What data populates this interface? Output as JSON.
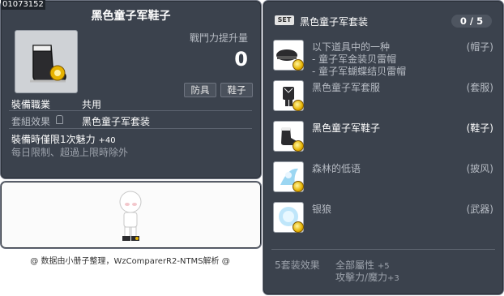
{
  "item_id": "01073152",
  "item": {
    "name": "黑色童子军鞋子",
    "combat_power_label": "戰鬥力提升量",
    "combat_power_value": "0",
    "tags": [
      "防具",
      "鞋子"
    ],
    "job_label": "裝備職業",
    "job_value": "共用",
    "set_label": "套組效果",
    "set_value": "黑色童子军套装",
    "limit_text": "裝備時僅限1次魅力",
    "limit_value": "+40",
    "limit_note": "每日限制、超過上限時除外"
  },
  "footer_credit": "@ 数据由小册子整理，WzComparerR2-NTMS解析 @",
  "set_panel": {
    "badge": "SET",
    "title": "黑色童子军套装",
    "count": "0 / 5",
    "items": [
      {
        "name": "以下道具中的一种",
        "sub": [
          "- 童子军金装贝雷帽",
          "- 童子军蝴蝶结贝雷帽"
        ],
        "type": "(帽子)",
        "icon": "beret-icon"
      },
      {
        "name": "黑色童子军套服",
        "sub": [],
        "type": "(套服)",
        "icon": "outfit-icon"
      },
      {
        "name": "黑色童子军鞋子",
        "sub": [],
        "type": "(鞋子)",
        "icon": "boots-icon"
      },
      {
        "name": "森林的低语",
        "sub": [],
        "type": "(披风)",
        "icon": "cape-icon"
      },
      {
        "name": "银狼",
        "sub": [],
        "type": "(武器)",
        "icon": "wolf-icon"
      }
    ],
    "effect_label": "5套装效果",
    "effects": [
      {
        "stat": "全部屬性",
        "value": "+5"
      },
      {
        "stat": "攻擊力/魔力",
        "value": "+3"
      }
    ]
  },
  "colors": {
    "panel_bg": "#3b424d",
    "panel_border": "#6c7280",
    "text_grey": "#b7bcc4"
  }
}
